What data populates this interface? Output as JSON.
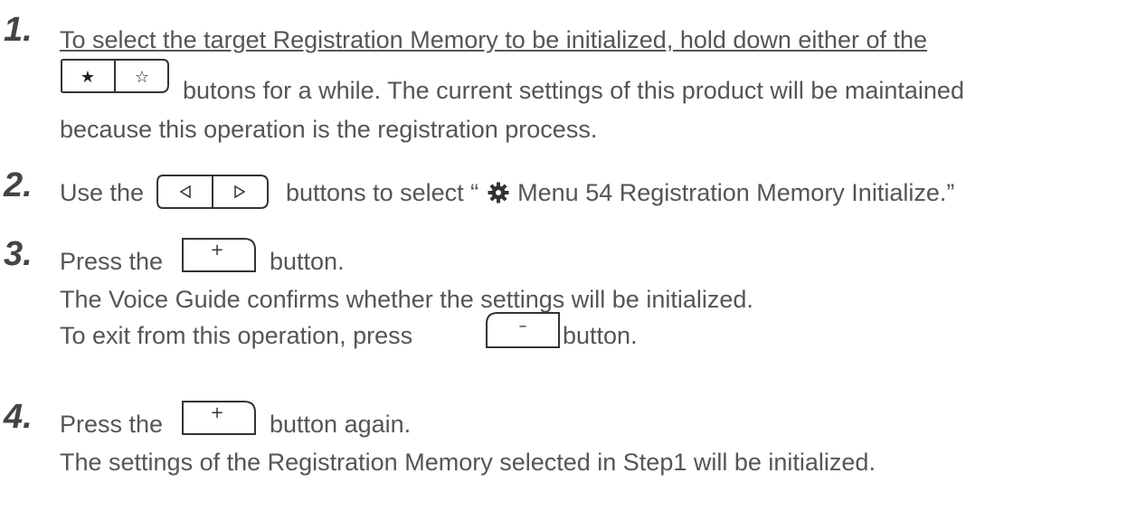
{
  "steps": [
    {
      "number": "1.",
      "lines": [
        "To select the target Registration Memory to be initialized, hold down either of the",
        "butons for a while. The current settings of this product will be maintained",
        "because this operation is the registration process."
      ],
      "keys": [
        {
          "type": "star-pair",
          "glyphs": [
            "★",
            "☆"
          ]
        }
      ]
    },
    {
      "number": "2.",
      "before": "Use the",
      "after_a": "buttons to select “",
      "after_b": "Menu 54 Registration Memory Initialize.”",
      "keys": [
        {
          "type": "arrow-pair",
          "glyphs": [
            "◃",
            "▹"
          ]
        }
      ],
      "icon": "gear-icon"
    },
    {
      "number": "3.",
      "before": "Press the",
      "after": "button.",
      "line2": "The Voice Guide confirms whether the settings will be initialized.",
      "line3_before": "To exit from this operation, press",
      "line3_after": "button.",
      "keys": [
        {
          "type": "plus",
          "glyph": "+"
        },
        {
          "type": "minus",
          "glyph": "–"
        }
      ]
    },
    {
      "number": "4.",
      "before": "Press the",
      "after": "button again.",
      "line2": "The settings of the Registration Memory selected in Step1 will be initialized.",
      "keys": [
        {
          "type": "plus",
          "glyph": "+"
        }
      ]
    }
  ]
}
